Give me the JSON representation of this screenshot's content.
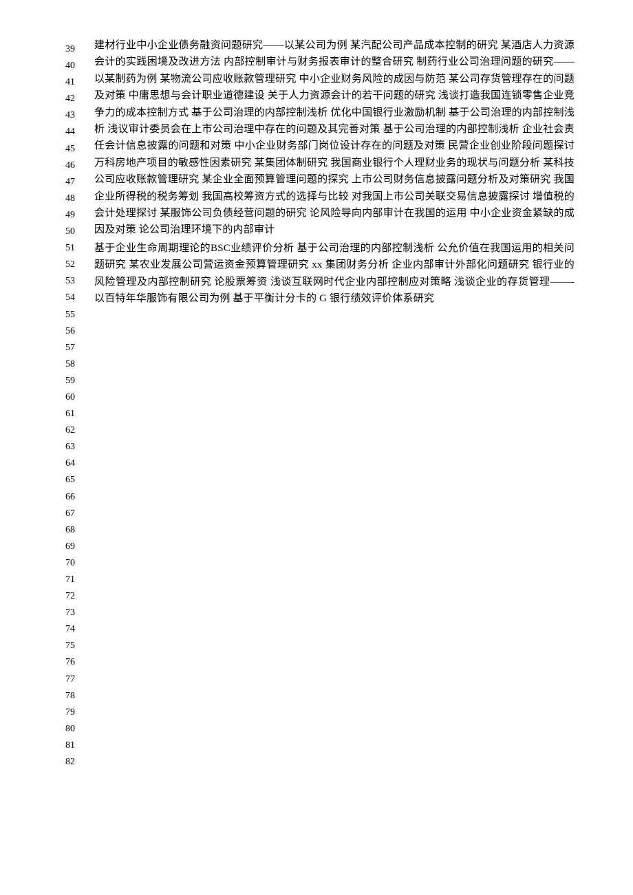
{
  "lineNumbers": [
    "39",
    "40",
    "41",
    "42",
    "43",
    "44",
    "45",
    "46",
    "47",
    "48",
    "49",
    "50",
    "51",
    "52",
    "53",
    "54",
    "55",
    "56",
    "57",
    "58",
    "59",
    "60",
    "61",
    "62",
    "63",
    "64",
    "65",
    "66",
    "67",
    "68",
    "69",
    "70",
    "71",
    "72",
    "73",
    "74",
    "75",
    "76",
    "77",
    "78",
    "79",
    "80",
    "81",
    "82"
  ],
  "paragraphs": [
    "建材行业中小企业债务融资问题研究――以某公司为例  某汽配公司产品成本控制的研究  某酒店人力资源会计的实践困境及改进方法  内部控制审计与财务报表审计的整合研究  制药行业公司治理问题的研究——以某制药为例  某物流公司应收账款管理研究  中小企业财务风险的成因与防范  某公司存货管理存在的问题及对策  中庸思想与会计职业道德建设  关于人力资源会计的若干问题的研究  浅谈打造我国连锁零售企业竞争力的成本控制方式  基于公司治理的内部控制浅析  优化中国银行业激励机制  基于公司治理的内部控制浅析  浅议审计委员会在上市公司治理中存在的问题及其完善对策  基于公司治理的内部控制浅析  企业社会责任会计信息披露的问题和对策  中小企业财务部门岗位设计存在的问题及对策  民营企业创业阶段问题探讨  万科房地产项目的敏感性因素研究  某集团体制研究  我国商业银行个人理财业务的现状与问题分析  某科技公司应收账款管理研究  某企业全面预算管理问题的探究  上市公司财务信息披露问题分析及对策研究  我国企业所得税的税务筹划  我国高校筹资方式的选择与比较  对我国上市公司关联交易信息披露探讨  增值税的会计处理探讨  某服饰公司负债经营问题的研究  论风险导向内部审计在我国的运用  中小企业资金紧缺的成因及对策  论公司治理环境下的内部审计",
    "基于企业生命周期理论的BSC业绩评价分析  基于公司治理的内部控制浅析  公允价值在我国运用的相关问题研究  某农业发展公司营运资金预算管理研究  xx 集团财务分析  企业内部审计外部化问题研究  银行业的风险管理及内部控制研究  论股票筹资  浅谈互联网时代企业内部控制应对策略  浅谈企业的存货管理――-以百特年华服饰有限公司为例  基于平衡计分卡的  G 银行绩效评价体系研究"
  ]
}
